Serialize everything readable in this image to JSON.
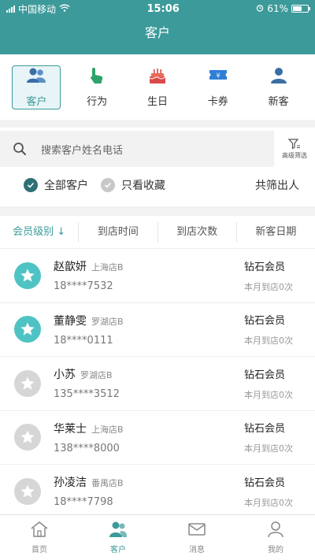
{
  "status_bar": {
    "carrier": "中国移动",
    "time": "15:06",
    "battery": "61%"
  },
  "nav": {
    "title": "客户"
  },
  "tabs": [
    {
      "label": "客户",
      "icon": "people-icon",
      "active": true
    },
    {
      "label": "行为",
      "icon": "pointer-hand-icon",
      "active": false
    },
    {
      "label": "生日",
      "icon": "cake-icon",
      "active": false
    },
    {
      "label": "卡券",
      "icon": "ticket-icon",
      "active": false
    },
    {
      "label": "新客",
      "icon": "person-icon",
      "active": false
    }
  ],
  "search": {
    "placeholder": "搜索客户姓名电话",
    "filter_label": "高级筛选"
  },
  "filters": {
    "all_label": "全部客户",
    "fav_label": "只看收藏",
    "count_text": "共筛出人"
  },
  "sort": [
    {
      "label": "会员级别 ↓",
      "active": true
    },
    {
      "label": "到店时间",
      "active": false
    },
    {
      "label": "到店次数",
      "active": false
    },
    {
      "label": "新客日期",
      "active": false
    }
  ],
  "customers": [
    {
      "name": "赵歆妍",
      "store": "上海店B",
      "phone": "18****7532",
      "level": "钻石会员",
      "visits": "本月到店0次",
      "starred": true
    },
    {
      "name": "董静雯",
      "store": "罗湖店B",
      "phone": "18****0111",
      "level": "钻石会员",
      "visits": "本月到店0次",
      "starred": true
    },
    {
      "name": "小苏",
      "store": "罗湖店B",
      "phone": "135****3512",
      "level": "钻石会员",
      "visits": "本月到店0次",
      "starred": false
    },
    {
      "name": "华莱士",
      "store": "上海店B",
      "phone": "138****8000",
      "level": "钻石会员",
      "visits": "本月到店0次",
      "starred": false
    },
    {
      "name": "孙凌洁",
      "store": "番禺店B",
      "phone": "18****7798",
      "level": "钻石会员",
      "visits": "本月到店0次",
      "starred": false
    }
  ],
  "bottom_nav": [
    {
      "label": "首页",
      "icon": "home-icon",
      "active": false
    },
    {
      "label": "客户",
      "icon": "customer-icon",
      "active": true
    },
    {
      "label": "消息",
      "icon": "mail-icon",
      "active": false
    },
    {
      "label": "我的",
      "icon": "profile-icon",
      "active": false
    }
  ],
  "colors": {
    "primary": "#3d9a9b",
    "star_active": "#4fc3c3",
    "star_inactive": "#d6d6d6"
  }
}
